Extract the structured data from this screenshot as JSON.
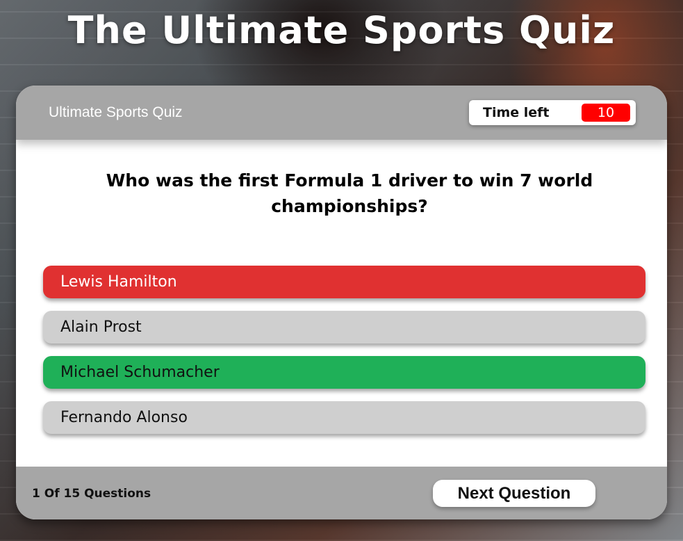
{
  "page": {
    "title": "The Ultimate Sports Quiz"
  },
  "header": {
    "title": "Ultimate Sports Quiz",
    "timer_label": "Time left",
    "timer_value": "10"
  },
  "question": {
    "text": "Who was the first Formula 1 driver to win 7 world championships?"
  },
  "options": [
    {
      "label": "Lewis Hamilton",
      "state": "wrong",
      "color": "#e03131"
    },
    {
      "label": "Alain Prost",
      "state": "neutral",
      "color": "#cfcfcf"
    },
    {
      "label": "Michael Schumacher",
      "state": "correct",
      "color": "#1fb058"
    },
    {
      "label": "Fernando Alonso",
      "state": "neutral",
      "color": "#cfcfcf"
    }
  ],
  "footer": {
    "progress": "1 Of 15 Questions",
    "next_label": "Next Question"
  },
  "colors": {
    "header_bg": "#a6a6a6",
    "timer_bg": "#ff0000",
    "card_bg": "#ffffff"
  }
}
